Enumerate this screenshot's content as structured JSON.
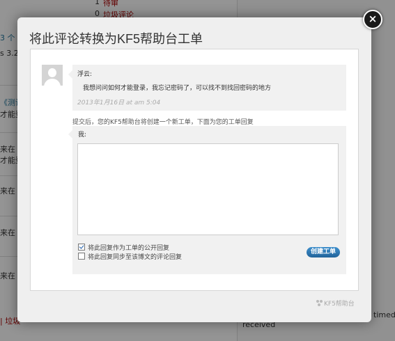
{
  "background": {
    "top_count_1": "1",
    "top_label_1": "待审",
    "top_count_2": "0",
    "top_label_2": "垃圾评论",
    "left_fragments": [
      "3 个",
      "s 3.2",
      "《测试",
      "才能登",
      "来在《",
      "才能登",
      "来在《",
      "来在《",
      "来在《",
      "来在《",
      "| 垃圾"
    ],
    "right_fragment_1": "timed",
    "right_fragment_2": "received"
  },
  "modal": {
    "title": "将此评论转换为KF5帮助台工单",
    "close_glyph": "×"
  },
  "comment": {
    "author": "浮云:",
    "body": "我想问问如何才能登录，我忘记密码了，可以找不到找回密码的地方",
    "date": "2013年1月16日 at am 5:04"
  },
  "notice": "提交后，您的KF5帮助台将创建一个新工单，下面为您的工单回复",
  "reply": {
    "label": "我:",
    "value": ""
  },
  "options": [
    {
      "label": "将此回复作为工单的公开回复",
      "checked": true
    },
    {
      "label": "将此回复同步至该博文的评论回复",
      "checked": false
    }
  ],
  "create_button": "创建工单",
  "footer_brand": "KF5帮助台",
  "colors": {
    "accent": "#2e7ab3",
    "overlay": "#8f8f8f"
  }
}
